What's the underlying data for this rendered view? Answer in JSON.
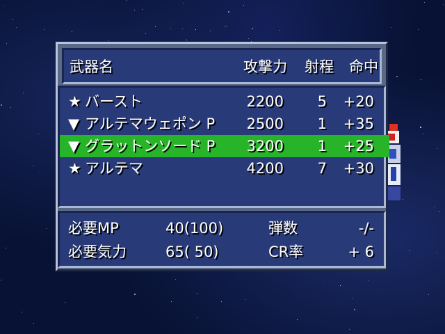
{
  "header": {
    "weapon_name": "武器名",
    "attack": "攻撃力",
    "range": "射程",
    "hit": "命中"
  },
  "weapons": [
    {
      "marker": "★",
      "name": "バースト",
      "attack": "2200",
      "range": "5",
      "hit": "+20",
      "selected": false
    },
    {
      "marker": "▼",
      "name": "アルテマウェポン P",
      "attack": "2500",
      "range": "1",
      "hit": "+35",
      "selected": false
    },
    {
      "marker": "▼",
      "name": "グラットンソード P",
      "attack": "3200",
      "range": "1",
      "hit": "+25",
      "selected": true
    },
    {
      "marker": "★",
      "name": "アルテマ",
      "attack": "4200",
      "range": "7",
      "hit": "+30",
      "selected": false
    }
  ],
  "details": {
    "mp_label": "必要MP",
    "mp_value": "40(100)",
    "ammo_label": "弾数",
    "ammo_value": "-/-",
    "will_label": "必要気力",
    "will_value": "65( 50)",
    "crit_label": "CR率",
    "crit_value": "+ 6"
  },
  "colors": {
    "selected_row": "#28b428",
    "panel": "#283a78",
    "frame": "#5a6888",
    "text": "#ffffff"
  }
}
